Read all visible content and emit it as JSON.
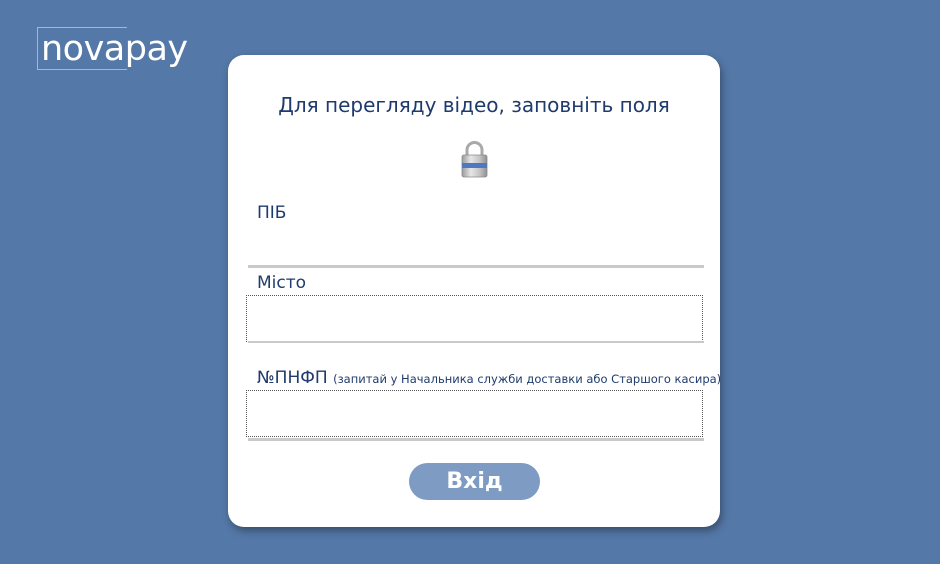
{
  "brand": {
    "logo_text": "novapay"
  },
  "form": {
    "title": "Для перегляду відео, заповніть поля",
    "lock_icon": "lock-icon",
    "fields": {
      "pib": {
        "label": "ПІБ",
        "value": ""
      },
      "city": {
        "label": "Місто",
        "value": ""
      },
      "pnfp": {
        "label": "№ПНФП",
        "hint": "(запитай у Начальника служби доставки або Старшого касира)",
        "value": ""
      }
    },
    "submit_label": "Вхід"
  },
  "colors": {
    "background": "#5478a7",
    "card": "#ffffff",
    "text": "#1f3b6e",
    "button": "#7d9bc3"
  }
}
